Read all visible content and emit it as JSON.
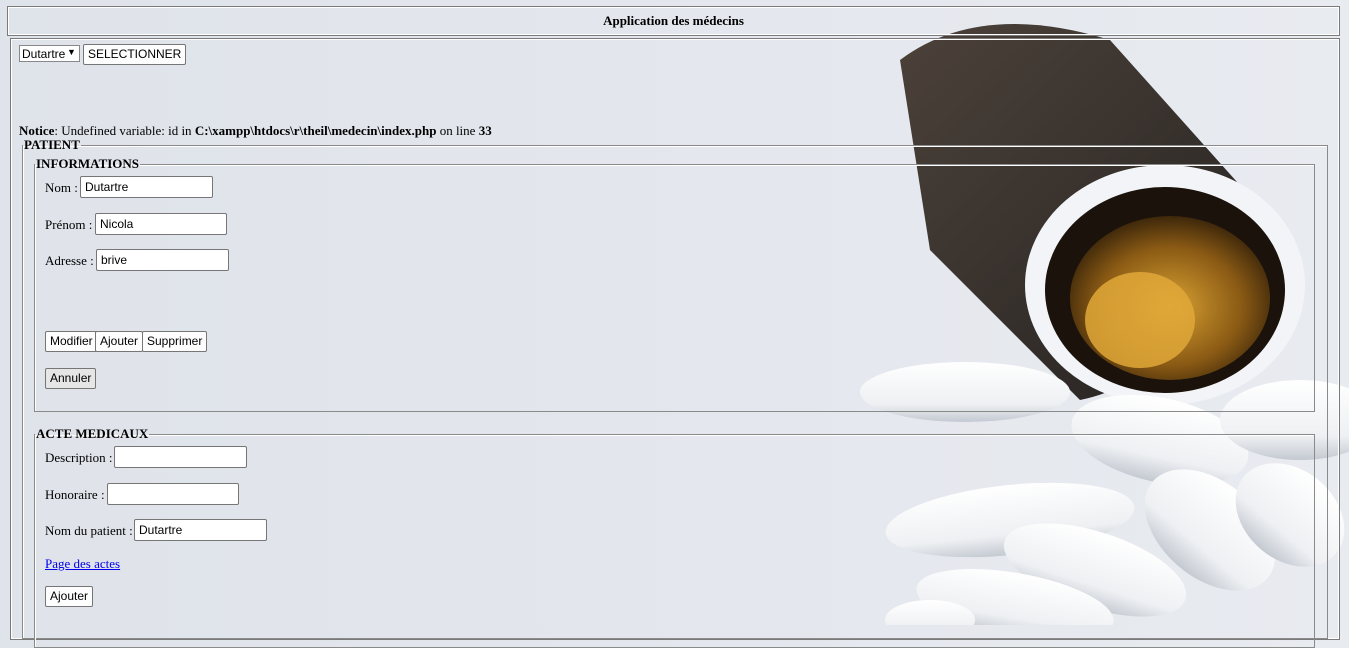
{
  "header": {
    "title": "Application des médecins"
  },
  "selector": {
    "selected": "Dutartre",
    "options": [
      "Dutartre"
    ],
    "button_label": "SELECTIONNER"
  },
  "notice": {
    "label": "Notice",
    "text1": ": Undefined variable: id in ",
    "path": "C:\\xampp\\htdocs\\r\\theil\\medecin\\index.php",
    "text2": " on line ",
    "line": "33"
  },
  "patient": {
    "legend": "PATIENT",
    "informations": {
      "legend": "INFORMATIONS",
      "nom_label": "Nom :",
      "nom_value": "Dutartre",
      "prenom_label": "Prénom :",
      "prenom_value": "Nicola",
      "adresse_label": "Adresse :",
      "adresse_value": "brive",
      "modifier": "Modifier",
      "ajouter": "Ajouter",
      "supprimer": "Supprimer",
      "annuler": "Annuler"
    },
    "actes": {
      "legend": "ACTE MEDICAUX",
      "description_label": "Description :",
      "description_value": "",
      "honoraire_label": "Honoraire :",
      "honoraire_value": "",
      "nom_patient_label": "Nom du patient :",
      "nom_patient_value": "Dutartre",
      "link": "Page des actes",
      "ajouter": "Ajouter"
    }
  },
  "colors": {
    "link": "#0000ee",
    "border": "#7a7a7a"
  }
}
